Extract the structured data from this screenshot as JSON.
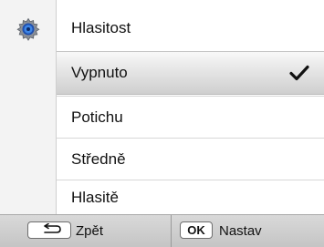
{
  "header": {
    "title": "Hlasitost",
    "icon": "settings-icon"
  },
  "options": [
    {
      "label": "Vypnuto",
      "selected": true
    },
    {
      "label": "Potichu",
      "selected": false
    },
    {
      "label": "Středně",
      "selected": false
    },
    {
      "label": "Hlasitě",
      "selected": false
    }
  ],
  "bottom_bar": {
    "back_key": "back-arrow-icon",
    "back_label": "Zpět",
    "ok_key": "OK",
    "ok_label": "Nastav"
  },
  "colors": {
    "accent_icon": "#2f6fd1",
    "check": "#111111"
  }
}
